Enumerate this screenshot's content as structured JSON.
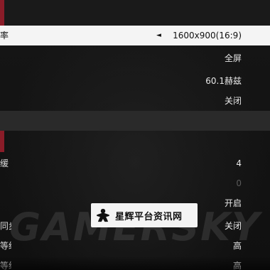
{
  "settings": {
    "resolution": {
      "label": "率",
      "value": "1600x900(16:9)",
      "arrow": "◄"
    },
    "display_mode": {
      "value": "全屏"
    },
    "refresh_rate": {
      "value": "60.1赫兹"
    },
    "option_off_1": {
      "value": "关闭"
    },
    "row_4": {
      "label": "缓",
      "value": "4"
    },
    "row_dim": {
      "label": "",
      "value": "0"
    },
    "row_on": {
      "value": "开启"
    },
    "vsync": {
      "label": "同步",
      "value": "关闭"
    },
    "quality_1": {
      "label": "等级",
      "value": "高"
    },
    "quality_2": {
      "label": "等级",
      "value": "高"
    }
  },
  "watermark": {
    "text": "GAMERSKY",
    "logo_text": "星辉平台资讯网"
  },
  "colors": {
    "accent": "#8a1c28",
    "selected_bg": "#f4f4f4",
    "bg": "#121212"
  }
}
